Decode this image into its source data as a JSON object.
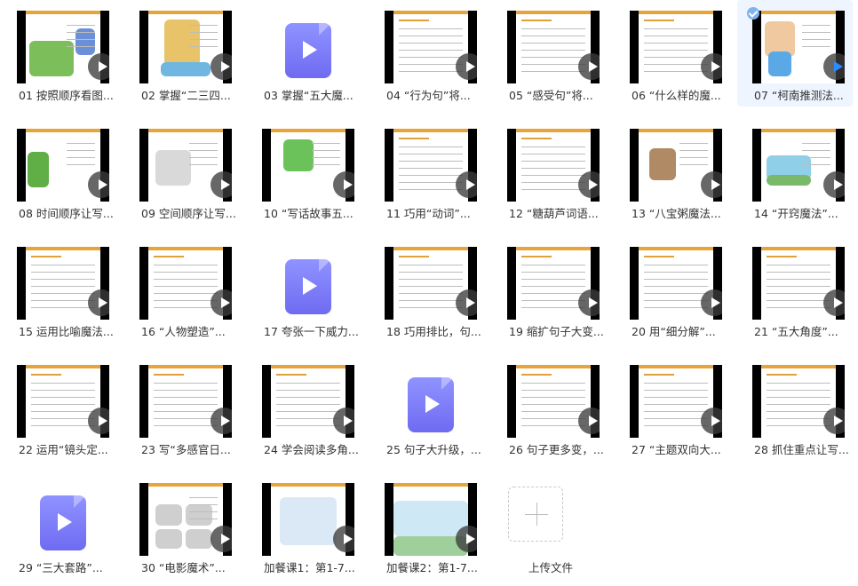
{
  "colors": {
    "accent_bar": "#e7a43a",
    "video_icon": "#7d7cf5",
    "selected_bg": "#eef5ff",
    "play_selected": "#2b8cff"
  },
  "items": [
    {
      "label": "01 按照顺序看图...",
      "kind": "thumb",
      "icon": "play-icon",
      "art": "scene-green"
    },
    {
      "label": "02 掌握“二三四...",
      "kind": "thumb",
      "icon": "play-icon",
      "art": "scene-kid"
    },
    {
      "label": "03 掌握“五大魔...",
      "kind": "video",
      "icon": "video-file-icon"
    },
    {
      "label": "04 “行为句”将...",
      "kind": "thumb",
      "icon": "play-icon",
      "art": "text"
    },
    {
      "label": "05 “感受句”将...",
      "kind": "thumb",
      "icon": "play-icon",
      "art": "text"
    },
    {
      "label": "06 “什么样的魔...",
      "kind": "thumb",
      "icon": "play-icon",
      "art": "text"
    },
    {
      "label": "07 “柯南推测法...",
      "kind": "thumb",
      "icon": "play-icon",
      "art": "scene-boy",
      "selected": true
    },
    {
      "label": "08 时间顺序让写...",
      "kind": "thumb",
      "icon": "play-icon",
      "art": "scene-tree"
    },
    {
      "label": "09 空间顺序让写...",
      "kind": "thumb",
      "icon": "play-icon",
      "art": "scene-sketch"
    },
    {
      "label": "10 “写话故事五...",
      "kind": "thumb",
      "icon": "play-icon",
      "art": "scene-frog"
    },
    {
      "label": "11 巧用“动词”...",
      "kind": "thumb",
      "icon": "play-icon",
      "art": "text"
    },
    {
      "label": "12 “糖葫芦词语...",
      "kind": "thumb",
      "icon": "play-icon",
      "art": "text"
    },
    {
      "label": "13 “八宝粥魔法...",
      "kind": "thumb",
      "icon": "play-icon",
      "art": "scene-bird"
    },
    {
      "label": "14 “开窍魔法”...",
      "kind": "thumb",
      "icon": "play-icon",
      "art": "scene-lake"
    },
    {
      "label": "15 运用比喻魔法...",
      "kind": "thumb",
      "icon": "play-icon",
      "art": "text"
    },
    {
      "label": "16 “人物塑造”...",
      "kind": "thumb",
      "icon": "play-icon",
      "art": "text"
    },
    {
      "label": "17 夸张一下威力...",
      "kind": "video",
      "icon": "video-file-icon"
    },
    {
      "label": "18 巧用排比，句...",
      "kind": "thumb",
      "icon": "play-icon",
      "art": "text"
    },
    {
      "label": "19 缩扩句子大变...",
      "kind": "thumb",
      "icon": "play-icon",
      "art": "text"
    },
    {
      "label": "20 用“细分解”...",
      "kind": "thumb",
      "icon": "play-icon",
      "art": "text"
    },
    {
      "label": "21 “五大角度”...",
      "kind": "thumb",
      "icon": "play-icon",
      "art": "text"
    },
    {
      "label": "22 运用“镜头定...",
      "kind": "thumb",
      "icon": "play-icon",
      "art": "text"
    },
    {
      "label": "23 写“多感官日...",
      "kind": "thumb",
      "icon": "play-icon",
      "art": "text"
    },
    {
      "label": "24 学会阅读多角...",
      "kind": "thumb",
      "icon": "play-icon",
      "art": "text"
    },
    {
      "label": "25 句子大升级，...",
      "kind": "video",
      "icon": "video-file-icon"
    },
    {
      "label": "26 句子更多变，...",
      "kind": "thumb",
      "icon": "play-icon",
      "art": "text"
    },
    {
      "label": "27 “主题双向大...",
      "kind": "thumb",
      "icon": "play-icon",
      "art": "text"
    },
    {
      "label": "28 抓住重点让写...",
      "kind": "thumb",
      "icon": "play-icon",
      "art": "text"
    },
    {
      "label": "29 “三大套路”...",
      "kind": "video",
      "icon": "video-file-icon"
    },
    {
      "label": "30 “电影魔术”...",
      "kind": "thumb",
      "icon": "play-icon",
      "art": "scene-comic"
    },
    {
      "label": "加餐课1：第1-7...",
      "kind": "thumb",
      "icon": "play-icon",
      "art": "scene-mindmap"
    },
    {
      "label": "加餐课2：第1-7...",
      "kind": "thumb",
      "icon": "play-icon",
      "art": "scene-sky"
    },
    {
      "label": "上传文件",
      "kind": "upload",
      "icon": "plus-icon"
    }
  ]
}
